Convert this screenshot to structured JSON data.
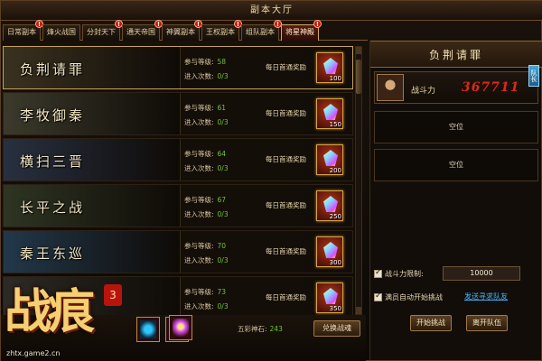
{
  "window": {
    "title": "副本大厅"
  },
  "tabs": [
    {
      "label": "日常副本",
      "badge": "!",
      "active": false
    },
    {
      "label": "烽火战国",
      "badge": "",
      "active": false
    },
    {
      "label": "分封天下",
      "badge": "!",
      "active": false
    },
    {
      "label": "通天帝国",
      "badge": "!",
      "active": false
    },
    {
      "label": "神翼副本",
      "badge": "!",
      "active": false
    },
    {
      "label": "王权副本",
      "badge": "!",
      "active": false
    },
    {
      "label": "组队副本",
      "badge": "!",
      "active": false
    },
    {
      "label": "将星神殿",
      "badge": "!",
      "active": true
    }
  ],
  "labels": {
    "level": "参与等级:",
    "entries": "进入次数:",
    "reward": "每日首通奖励"
  },
  "dungeons": [
    {
      "name": "负荆请罪",
      "level": "58",
      "entries": "0/3",
      "qty": "100",
      "theme": "#3a3220"
    },
    {
      "name": "李牧御秦",
      "level": "61",
      "entries": "0/3",
      "qty": "150",
      "theme": "#3b3a2c"
    },
    {
      "name": "横扫三晋",
      "level": "64",
      "entries": "0/3",
      "qty": "200",
      "theme": "#283040"
    },
    {
      "name": "长平之战",
      "level": "67",
      "entries": "0/3",
      "qty": "250",
      "theme": "#2e3522"
    },
    {
      "name": "秦王东巡",
      "level": "70",
      "entries": "0/3",
      "qty": "300",
      "theme": "#22384a"
    },
    {
      "name": "",
      "level": "73",
      "entries": "0/3",
      "qty": "350",
      "theme": "#2d2b26"
    }
  ],
  "bottom": {
    "stone_label": "五彩神石:",
    "stone_value": "243",
    "exchange_button": "兑换战魂"
  },
  "logo": {
    "big": "战痕",
    "seal": "3",
    "url": "zhtx.game2.cn"
  },
  "team_panel": {
    "title": "负荆请罪",
    "member_power_label": "战斗力",
    "member_power": "367711",
    "leader_badge": "队长",
    "empty_slot_1": "空位",
    "empty_slot_2": "空位",
    "power_limit_label": "战斗力限制:",
    "power_limit_value": "10000",
    "auto_start_label": "满员自动开始挑战",
    "recruit_link": "发送寻求队友",
    "start_button": "开始挑战",
    "leave_button": "离开队伍"
  },
  "colors": {
    "accent_gold": "#d3a85c",
    "level_green": "#6ec43a",
    "power_red": "#e0281c",
    "link_blue": "#45b6ff",
    "badge_red": "#c4170f"
  }
}
